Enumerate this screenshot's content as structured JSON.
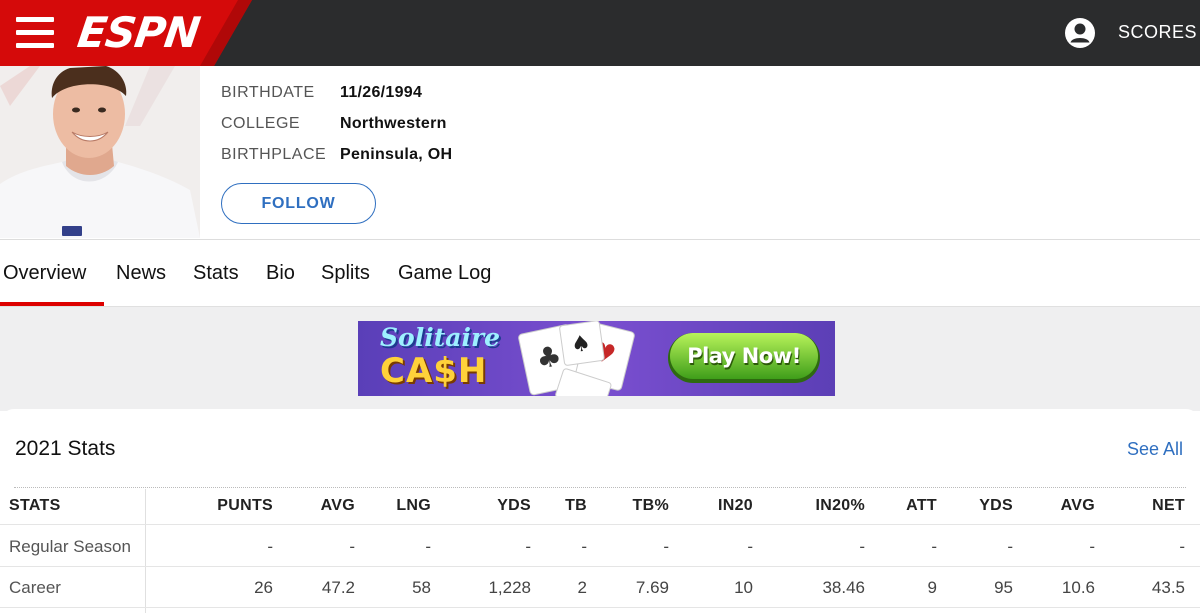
{
  "topbar": {
    "logo": "ESPN",
    "scores_label": "SCORES",
    "icons": {
      "menu": "hamburger-menu-icon",
      "user": "user-account-icon"
    },
    "colors": {
      "bar": "#2b2c2d",
      "brand_red": "#d50a0a"
    }
  },
  "player": {
    "info": [
      {
        "label": "BIRTHDATE",
        "value": "11/26/1994"
      },
      {
        "label": "COLLEGE",
        "value": "Northwestern"
      },
      {
        "label": "BIRTHPLACE",
        "value": "Peninsula, OH"
      }
    ],
    "follow_label": "FOLLOW"
  },
  "nav": {
    "tabs": [
      "Overview",
      "News",
      "Stats",
      "Bio",
      "Splits",
      "Game Log"
    ],
    "active": "Overview"
  },
  "ad": {
    "line1": "Solitaire",
    "line2": "CA$H",
    "cta": "Play Now!"
  },
  "stats": {
    "title": "2021 Stats",
    "see_all": "See All",
    "columns": [
      "STATS",
      "PUNTS",
      "AVG",
      "LNG",
      "YDS",
      "TB",
      "TB%",
      "IN20",
      "IN20%",
      "ATT",
      "YDS",
      "AVG",
      "NET"
    ],
    "rows": [
      {
        "label": "Regular Season",
        "values": [
          "-",
          "-",
          "-",
          "-",
          "-",
          "-",
          "-",
          "-",
          "-",
          "-",
          "-",
          "-"
        ]
      },
      {
        "label": "Career",
        "values": [
          "26",
          "47.2",
          "58",
          "1,228",
          "2",
          "7.69",
          "10",
          "38.46",
          "9",
          "95",
          "10.6",
          "43.5"
        ]
      }
    ]
  }
}
